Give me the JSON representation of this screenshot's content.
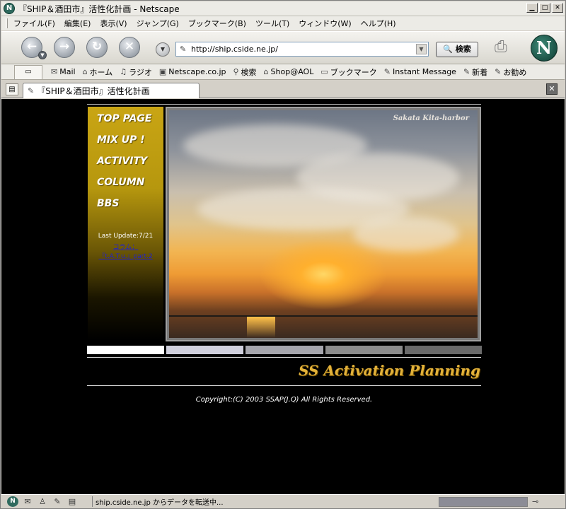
{
  "window": {
    "title": "『SHIP＆酒田市』活性化計画 - Netscape"
  },
  "menu": [
    "ファイル(F)",
    "編集(E)",
    "表示(V)",
    "ジャンプ(G)",
    "ブックマーク(B)",
    "ツール(T)",
    "ウィンドウ(W)",
    "ヘルプ(H)"
  ],
  "navbar": {
    "url": "http://ship.cside.ne.jp/",
    "search_label": "検索"
  },
  "personal_toolbar": [
    "Mail",
    "ホーム",
    "ラジオ",
    "Netscape.co.jp",
    "検索",
    "Shop@AOL",
    "ブックマーク",
    "Instant Message",
    "新着",
    "お勧め"
  ],
  "tab": {
    "label": "『SHIP＆酒田市』活性化計画"
  },
  "site": {
    "nav": [
      "TOP PAGE",
      "MIX UP !",
      "ACTIVITY",
      "COLUMN",
      "BBS"
    ],
    "last_update": "Last Update:7/21",
    "update_link_1": "コラム：",
    "update_link_2": "『t.A.T.u.』part.2",
    "photo_caption": "Sakata Kita-harbor",
    "brand": "SS Activation Planning",
    "copyright": "Copyright:(C) 2003 SSAP(J.Q) All Rights Reserved.",
    "bar_colors": [
      "#ffffff",
      "#cfcfdc",
      "#a6a6ad",
      "#8c8c8c",
      "#6a6a6a"
    ]
  },
  "status": {
    "text": "ship.cside.ne.jp からデータを転送中..."
  }
}
